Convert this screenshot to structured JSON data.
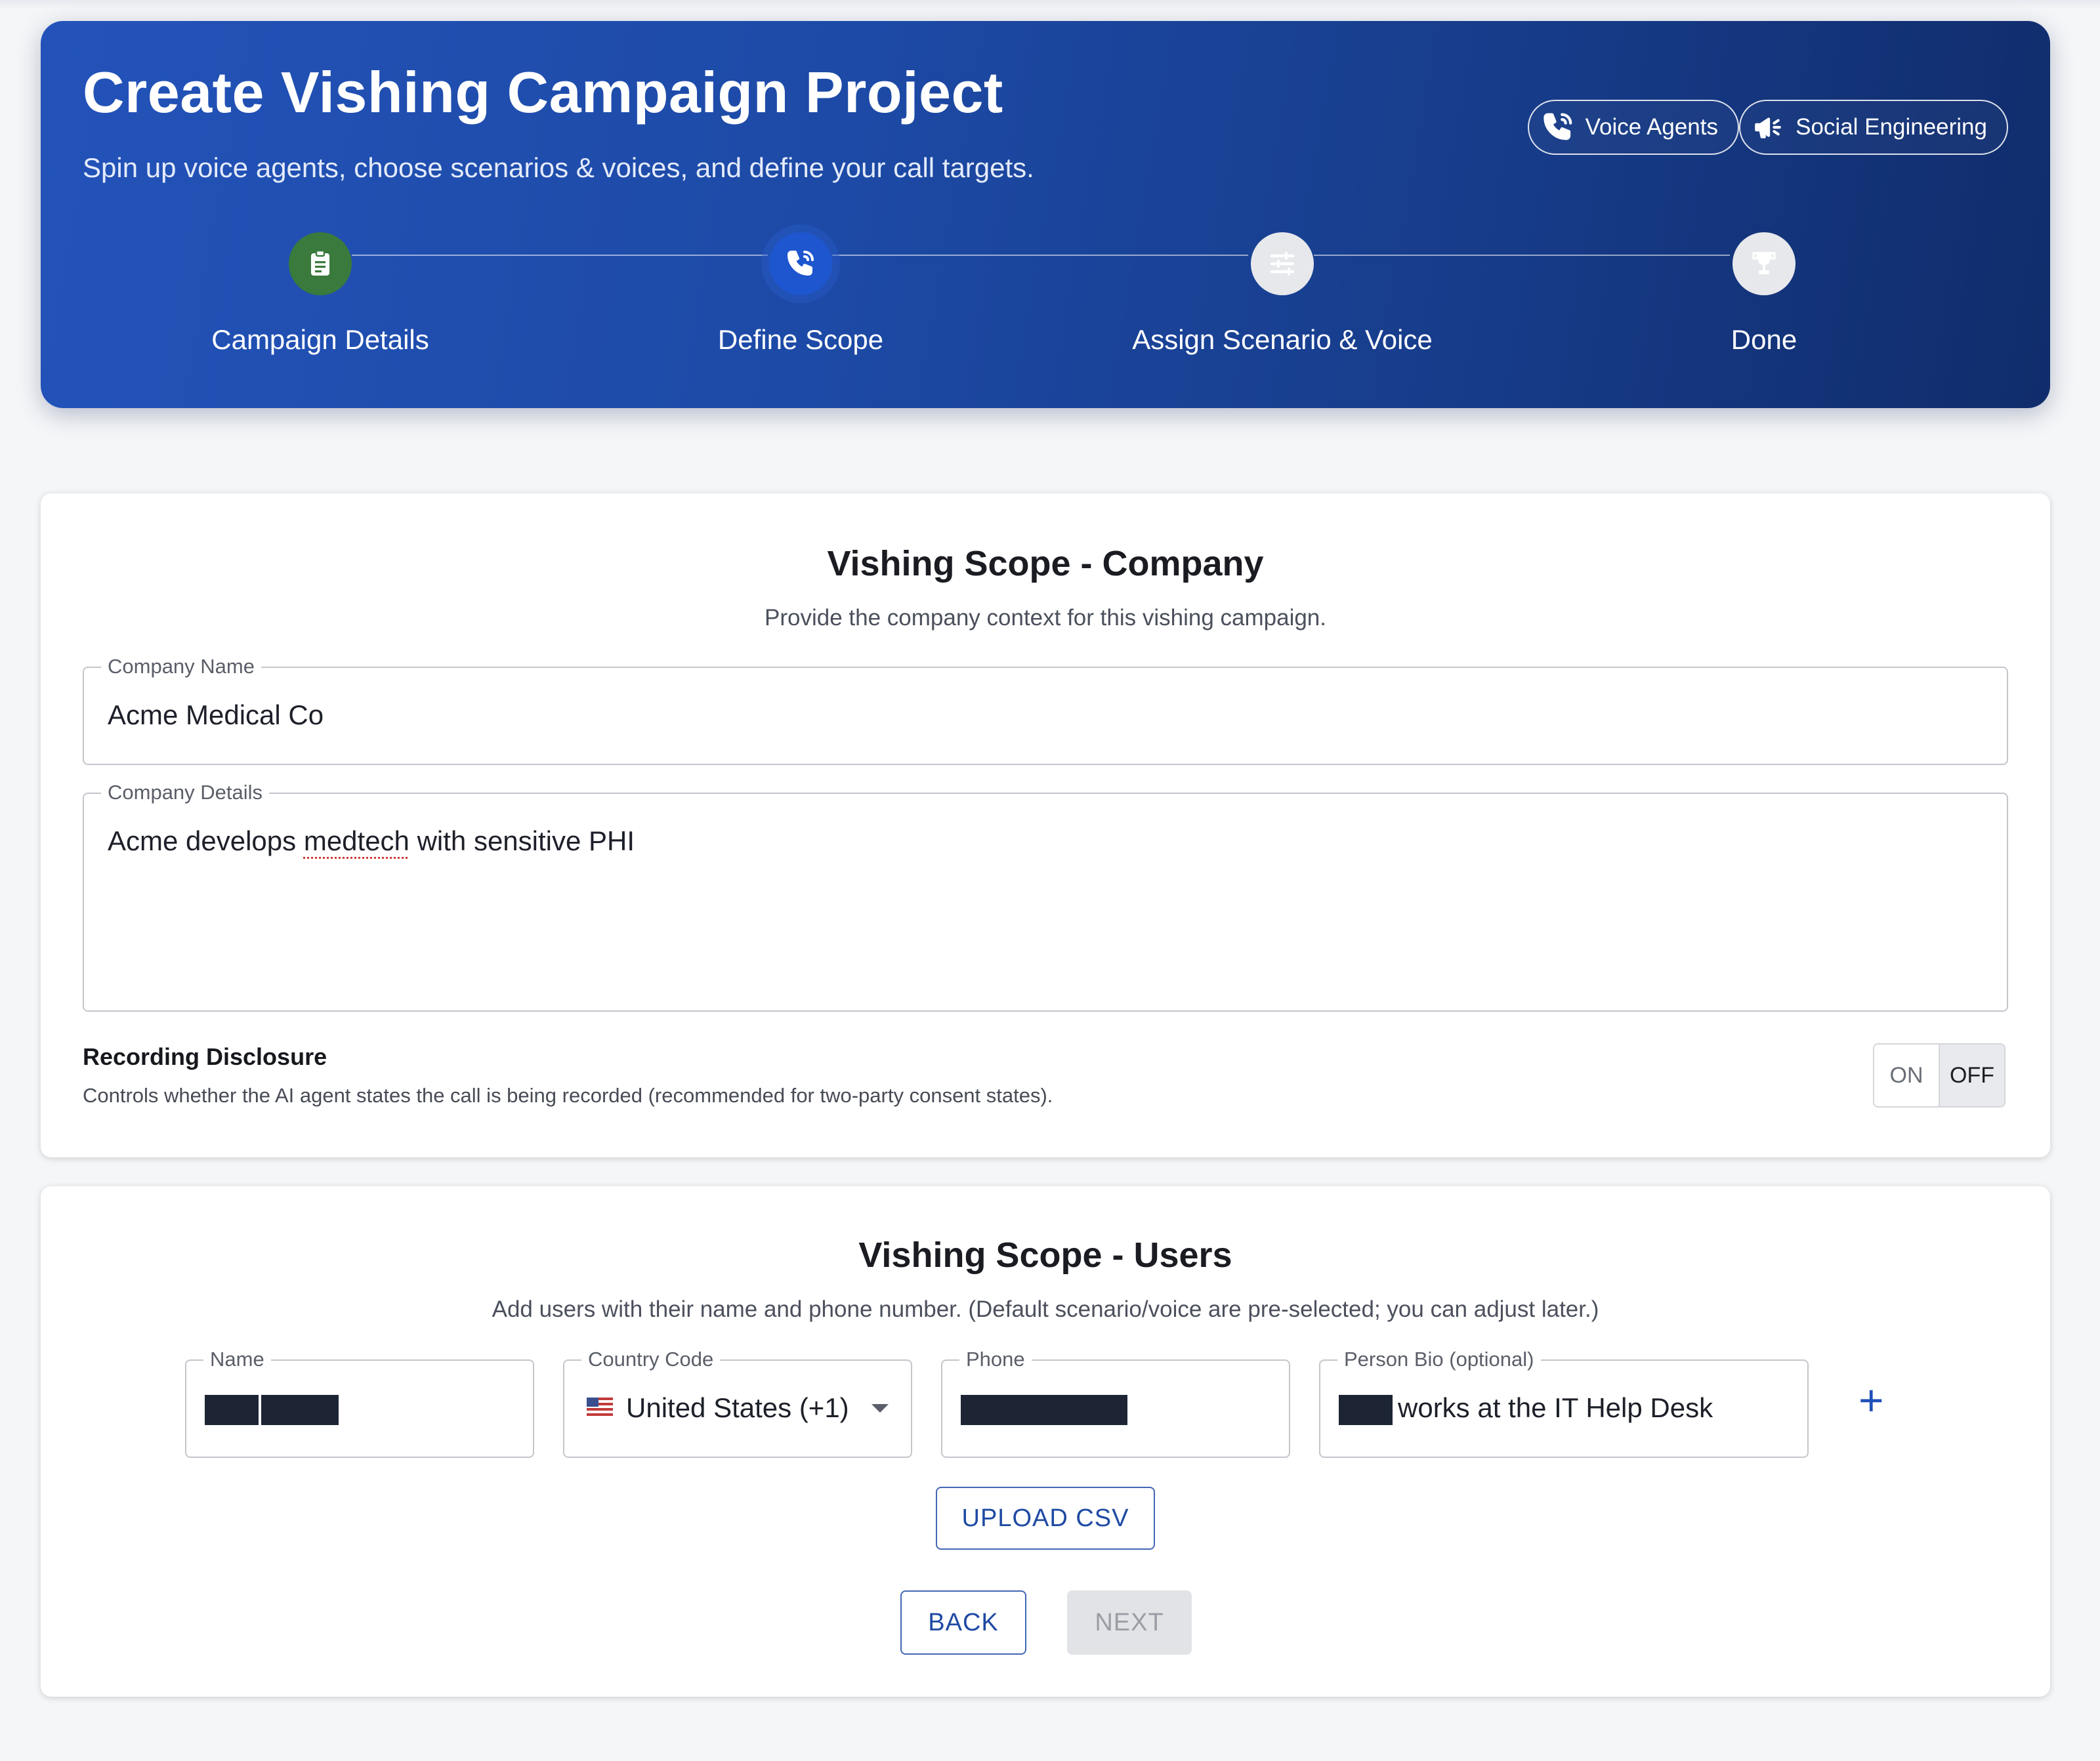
{
  "header": {
    "title": "Create Vishing Campaign Project",
    "subtitle": "Spin up voice agents, choose scenarios & voices, and define your call targets.",
    "chips": [
      {
        "label": "Voice Agents",
        "icon": "phone-call-icon"
      },
      {
        "label": "Social Engineering",
        "icon": "megaphone-icon"
      }
    ],
    "steps": [
      {
        "label": "Campaign Details",
        "status": "completed",
        "icon": "clipboard-icon",
        "color": "#3a7a3c"
      },
      {
        "label": "Define Scope",
        "status": "active",
        "icon": "phone-call-icon",
        "color": "#1e56cf"
      },
      {
        "label": "Assign Scenario & Voice",
        "status": "pending",
        "icon": "sliders-icon",
        "color": "#e6e8ec"
      },
      {
        "label": "Done",
        "status": "pending",
        "icon": "trophy-icon",
        "color": "#e6e8ec"
      }
    ]
  },
  "company": {
    "title": "Vishing Scope - Company",
    "description": "Provide the company context for this vishing campaign.",
    "name_label": "Company Name",
    "name_value": "Acme Medical Co",
    "details_label": "Company Details",
    "details_before": "Acme develops ",
    "details_misspelled": "medtech",
    "details_after": " with sensitive PHI",
    "recording_title": "Recording Disclosure",
    "recording_description": "Controls whether the AI agent states the call is being recorded (recommended for two-party consent states).",
    "toggle_on": "ON",
    "toggle_off": "OFF",
    "toggle_selected": "OFF"
  },
  "users": {
    "title": "Vishing Scope - Users",
    "description": "Add users with their name and phone number. (Default scenario/voice are pre-selected; you can adjust later.)",
    "name_label": "Name",
    "country_label": "Country Code",
    "country_value": "United States (+1)",
    "country_flag": "us-flag-icon",
    "phone_label": "Phone",
    "bio_label": "Person Bio (optional)",
    "bio_value": "works at the IT Help Desk",
    "add_icon": "plus-icon",
    "upload_label": "UPLOAD CSV",
    "back_label": "BACK",
    "next_label": "NEXT"
  },
  "colors": {
    "accent": "#1f4aa3",
    "header_start": "#2353b9",
    "header_end": "#102c6b",
    "step_done": "#3a7a3c",
    "step_active": "#1e56cf",
    "redaction": "#1d2535"
  }
}
